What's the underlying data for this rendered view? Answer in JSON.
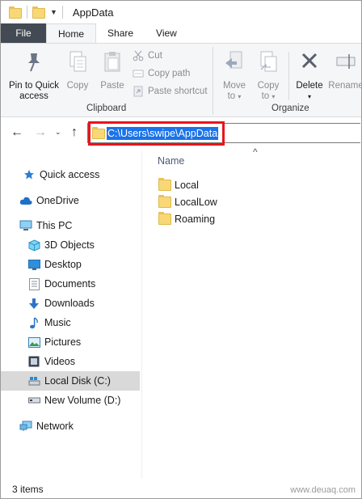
{
  "window": {
    "title": "AppData",
    "quick_access_toolbar": [
      "folder-icon",
      "folder-icon",
      "dropdown-arrow-icon"
    ]
  },
  "ribbon_tabs": {
    "file": "File",
    "home": "Home",
    "share": "Share",
    "view": "View"
  },
  "clipboard": {
    "pin": "Pin to Quick access",
    "pin_line1": "Pin to Quick",
    "pin_line2": "access",
    "copy": "Copy",
    "paste": "Paste",
    "cut": "Cut",
    "copy_path": "Copy path",
    "paste_shortcut": "Paste shortcut",
    "label": "Clipboard"
  },
  "organize": {
    "move_to": "Move",
    "move_to_2": "to",
    "copy_to": "Copy",
    "copy_to_2": "to",
    "delete": "Delete",
    "rename": "Rename",
    "label": "Organize"
  },
  "address_bar": {
    "path": "C:\\Users\\swipe\\AppData"
  },
  "sidebar": {
    "quick_access": "Quick access",
    "onedrive": "OneDrive",
    "this_pc": "This PC",
    "items": [
      {
        "label": "3D Objects",
        "icon": "3d-objects-icon"
      },
      {
        "label": "Desktop",
        "icon": "desktop-icon"
      },
      {
        "label": "Documents",
        "icon": "documents-icon"
      },
      {
        "label": "Downloads",
        "icon": "downloads-icon"
      },
      {
        "label": "Music",
        "icon": "music-icon"
      },
      {
        "label": "Pictures",
        "icon": "pictures-icon"
      },
      {
        "label": "Videos",
        "icon": "videos-icon"
      },
      {
        "label": "Local Disk (C:)",
        "icon": "disk-icon"
      },
      {
        "label": "New Volume (D:)",
        "icon": "drive-icon"
      }
    ],
    "network": "Network",
    "selected": "Local Disk (C:)"
  },
  "content": {
    "column_name": "Name",
    "files": [
      "Local",
      "LocalLow",
      "Roaming"
    ]
  },
  "status": {
    "item_count": "3 items"
  },
  "watermark": "www.deuaq.com",
  "colors": {
    "file_tab": "#444a54",
    "selection": "#1a73e8",
    "highlight_box": "#e8141b",
    "folder": "#f8d876"
  }
}
